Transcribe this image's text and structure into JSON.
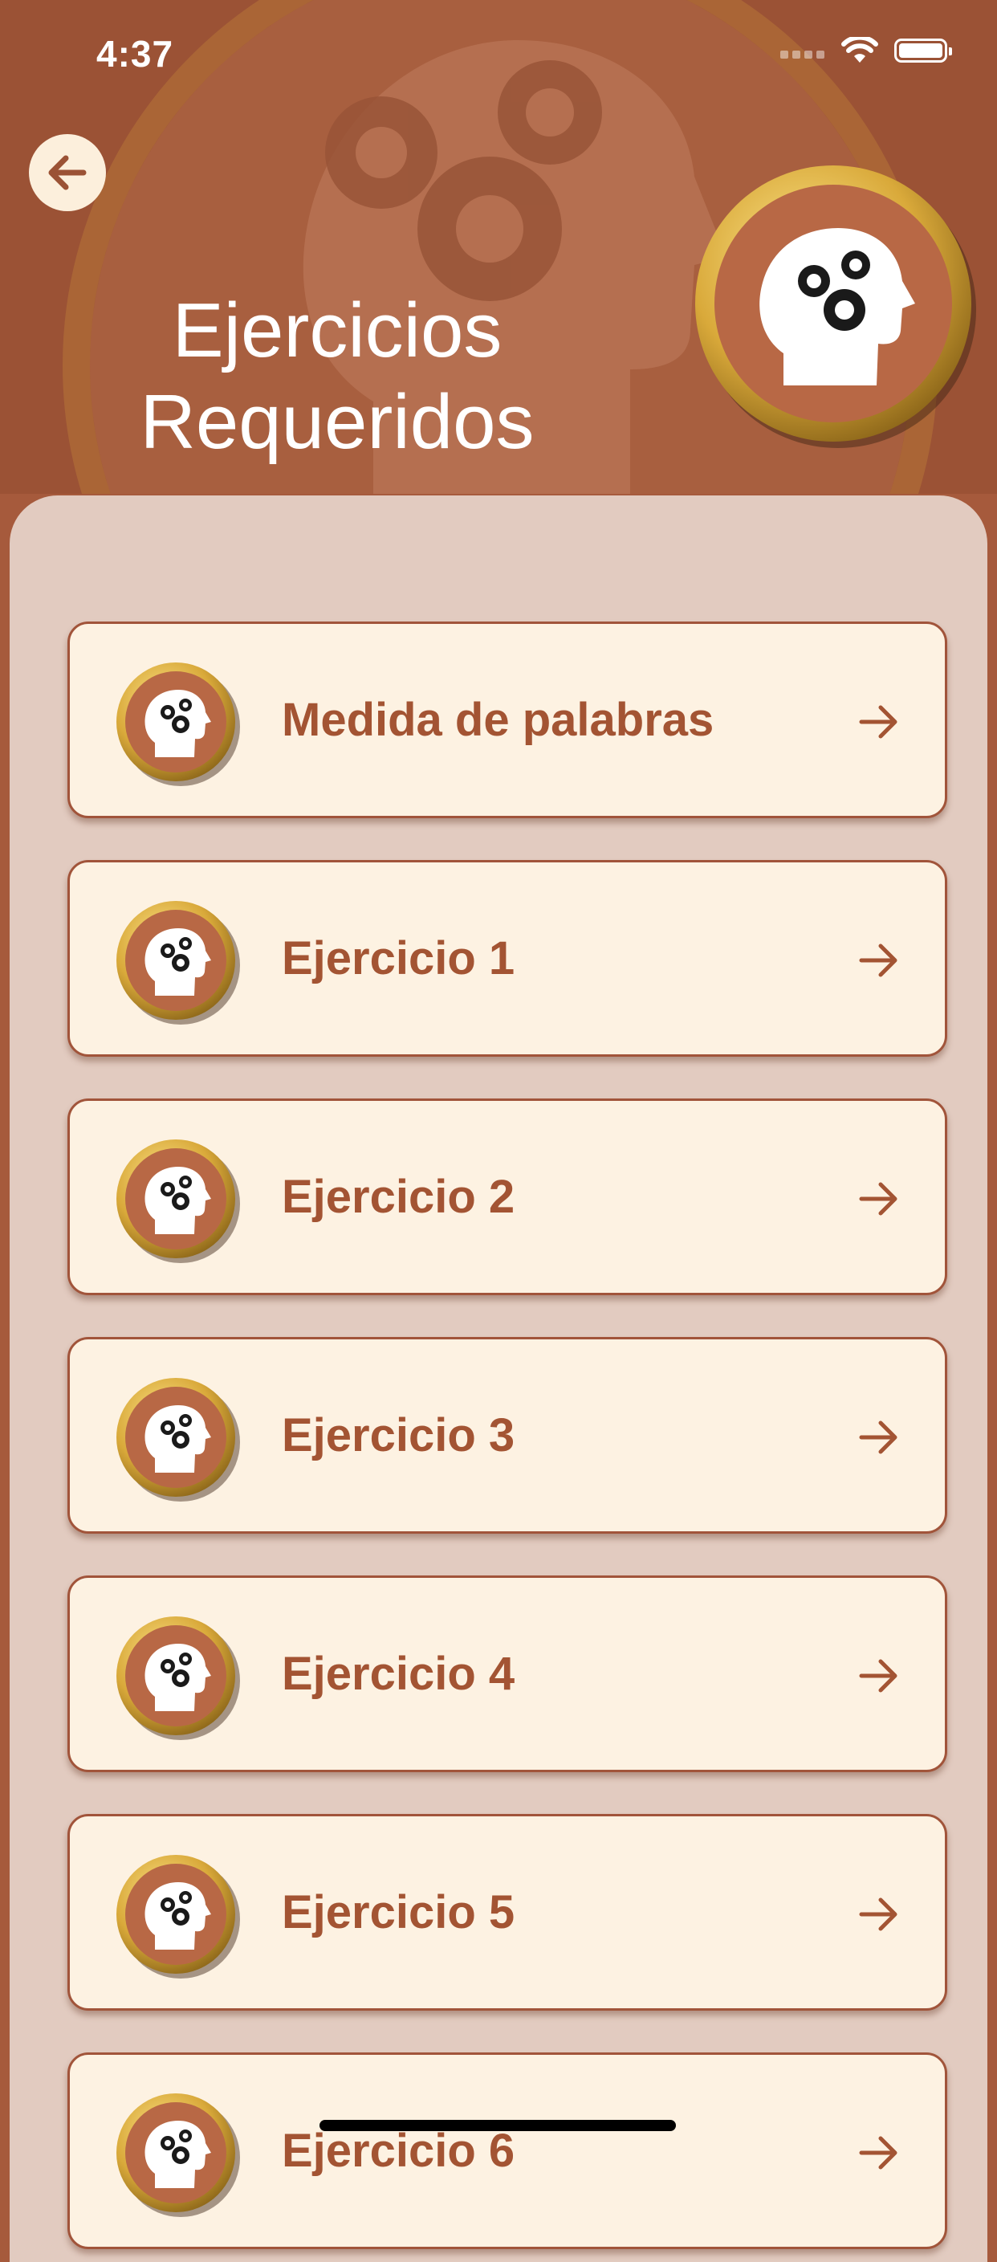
{
  "status_bar": {
    "time": "4:37"
  },
  "header": {
    "title_line1": "Ejercicios",
    "title_line2": "Requeridos"
  },
  "exercises": [
    {
      "label": "Medida de palabras"
    },
    {
      "label": "Ejercicio 1"
    },
    {
      "label": "Ejercicio 2"
    },
    {
      "label": "Ejercicio 3"
    },
    {
      "label": "Ejercicio 4"
    },
    {
      "label": "Ejercicio 5"
    },
    {
      "label": "Ejercicio 6"
    }
  ],
  "icons": {
    "back": "arrow-left-icon",
    "badge": "brain-gears-icon",
    "row_arrow": "arrow-right-icon"
  },
  "colors": {
    "header_bg": "#9b5235",
    "panel_bg": "#e2cbc0",
    "card_bg": "#fdf2e2",
    "accent": "#a35433",
    "badge_gold": "#d9a93a"
  }
}
